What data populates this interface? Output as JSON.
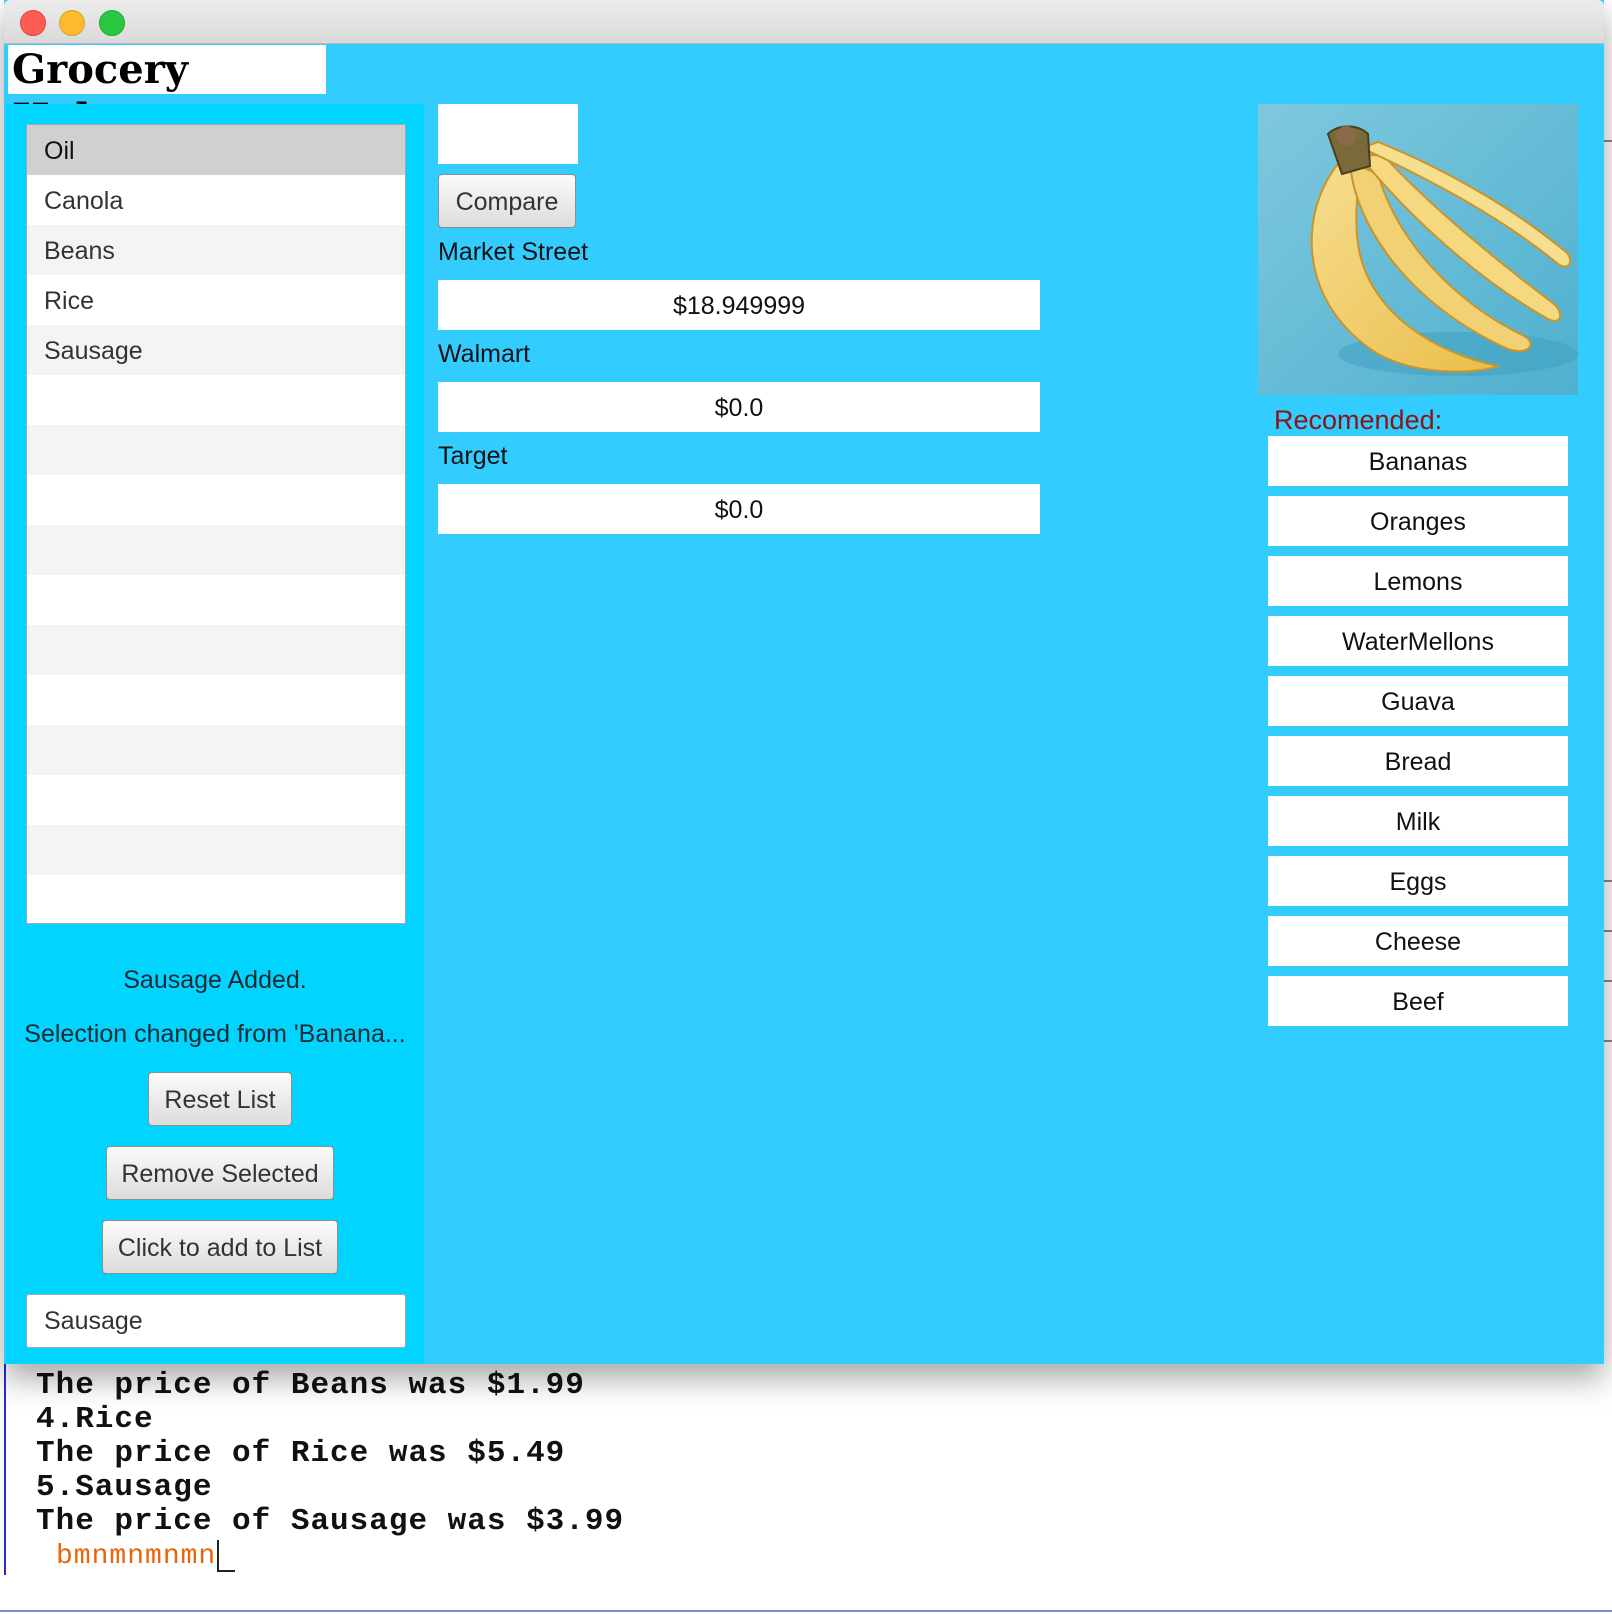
{
  "app": {
    "title": "Grocery Helper"
  },
  "grocery_list": {
    "items": [
      "Oil",
      "Canola",
      "Beans",
      "Rice",
      "Sausage"
    ],
    "selected": "Oil"
  },
  "status": {
    "added": "Sausage Added.",
    "selection_changed": "Selection changed from 'Banana..."
  },
  "buttons": {
    "reset": "Reset List",
    "remove": "Remove Selected",
    "add": "Click to add to List",
    "compare": "Compare"
  },
  "add_input": {
    "value": "Sausage"
  },
  "compare_input": {
    "value": ""
  },
  "stores": [
    {
      "name": "Market Street",
      "price": "$18.949999"
    },
    {
      "name": "Walmart",
      "price": "$0.0"
    },
    {
      "name": "Target",
      "price": "$0.0"
    }
  ],
  "recommended": {
    "label": "Recomended:",
    "items": [
      "Bananas",
      "Oranges",
      "Lemons",
      "WaterMellons",
      "Guava",
      "Bread",
      "Milk",
      "Eggs",
      "Cheese",
      "Beef"
    ]
  },
  "console": {
    "lines": [
      "The price of Beans was $1.99",
      "4.Rice",
      "The price of Rice was $5.49",
      "5.Sausage",
      "The price of Sausage was $3.99"
    ],
    "input": "bmnmnmnmn"
  },
  "colors": {
    "window_bg": "#33ccff",
    "left_panel_bg": "#00d4ff",
    "recommended_label": "#8b1414",
    "console_input": "#e8650a"
  },
  "image": {
    "subject": "bananas-photo"
  }
}
